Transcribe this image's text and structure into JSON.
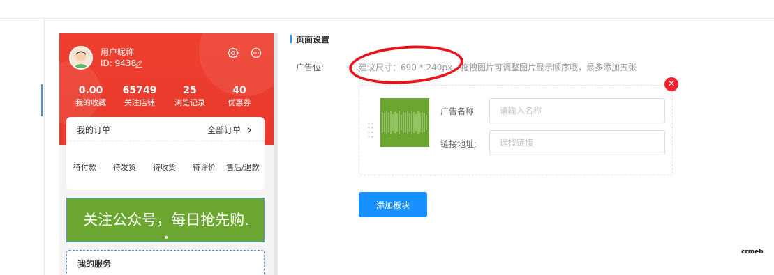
{
  "phone": {
    "nickname": "用户昵称",
    "user_id": "ID: 9438",
    "stats": [
      {
        "value": "0.00",
        "label": "我的收藏"
      },
      {
        "value": "65749",
        "label": "关注店铺"
      },
      {
        "value": "25",
        "label": "浏览记录"
      },
      {
        "value": "40",
        "label": "优惠券"
      }
    ],
    "orders": {
      "title": "我的订单",
      "all_label": "全部订单",
      "items": [
        "待付款",
        "待发货",
        "待收货",
        "待评价",
        "售后/退款"
      ]
    },
    "banner_text": "关注公众号，每日抢先购.",
    "service_title": "我的服务"
  },
  "panel": {
    "section_title": "页面设置",
    "ad_label": "广告位:",
    "hint": "建议尺寸：690 * 240px，拖拽图片可调整图片显示顺序哦，最多添加五张",
    "close_glyph": "×",
    "name_label": "广告名称",
    "name_placeholder": "请输入名称",
    "link_label": "链接地址:",
    "link_placeholder": "选择链接",
    "add_button": "添加板块"
  },
  "brand": "crmeb",
  "colors": {
    "hero_red": "#e8392b",
    "banner_green": "#6aa630",
    "primary_blue": "#1890ff",
    "highlight_red": "#e8141b"
  }
}
